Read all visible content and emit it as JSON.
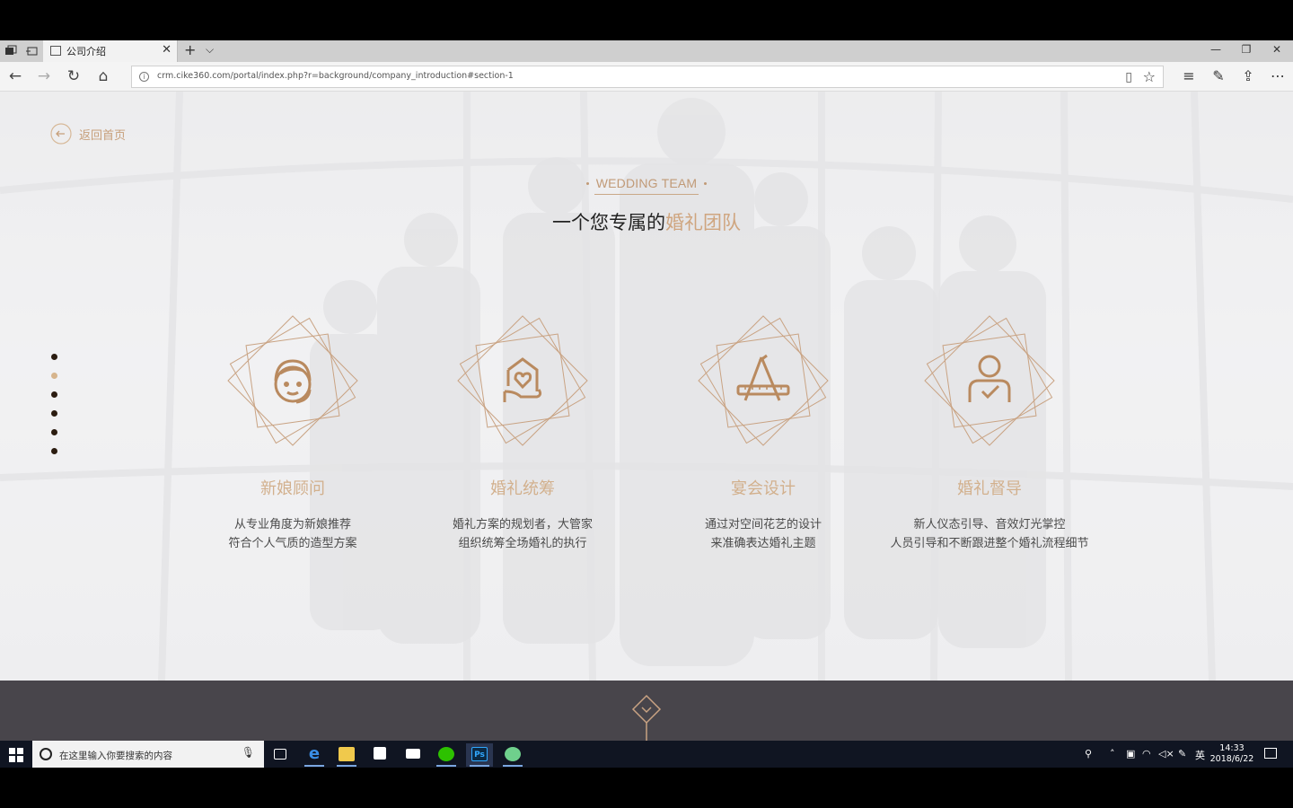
{
  "browser": {
    "tab_title": "公司介绍",
    "tab_close": "✕",
    "new_tab": "+",
    "tab_list": "⌵",
    "url": "crm.cike360.com/portal/index.php?r=background/company_introduction#section-1",
    "nav": {
      "back": "←",
      "forward": "→",
      "refresh": "↻",
      "home": "⌂"
    },
    "window": {
      "minimize": "—",
      "restore": "❐",
      "close": "✕"
    },
    "tools": {
      "favorites": "☆",
      "hub": "≡",
      "notes": "✎",
      "share": "⇪",
      "more": "⋯",
      "reading": "▯",
      "star": "☆"
    }
  },
  "page": {
    "back_label": "返回首页",
    "section_tag": "WEDDING TEAM",
    "title_plain": "一个您专属的",
    "title_accent": "婚礼团队",
    "pager_count": 6,
    "pager_active_index": 1,
    "accent_color": "#cfa57f",
    "features": [
      {
        "icon": "customer-service-icon",
        "title": "新娘顾问",
        "line1": "从专业角度为新娘推荐",
        "line2": "符合个人气质的造型方案"
      },
      {
        "icon": "heart-hand-icon",
        "title": "婚礼统筹",
        "line1": "婚礼方案的规划者，大管家",
        "line2": "组织统筹全场婚礼的执行"
      },
      {
        "icon": "design-tools-icon",
        "title": "宴会设计",
        "line1": "通过对空间花艺的设计",
        "line2": "来准确表达婚礼主题"
      },
      {
        "icon": "user-check-icon",
        "title": "婚礼督导",
        "line1": "新人仪态引导、音效灯光掌控",
        "line2": "人员引导和不断跟进整个婚礼流程细节"
      }
    ]
  },
  "taskbar": {
    "search_placeholder": "在这里输入你要搜索的内容",
    "apps": [
      "task-view",
      "edge",
      "file-explorer",
      "store",
      "mail",
      "wechat",
      "photoshop",
      "other-app"
    ],
    "tray_ime": "英",
    "time": "14:33",
    "date": "2018/6/22"
  }
}
